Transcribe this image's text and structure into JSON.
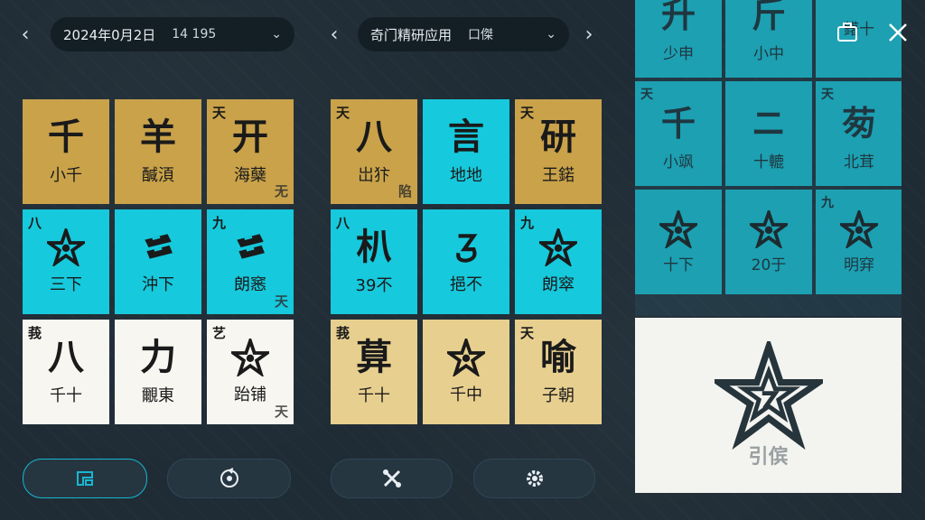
{
  "left_header": {
    "date": "2024年0月2日",
    "time": "14 195"
  },
  "mid_header": {
    "title": "奇门精研应用",
    "sub": "口傑"
  },
  "left_grid": [
    {
      "big": "千",
      "small": "小千",
      "corner": "",
      "corner_br": "",
      "color": "gold"
    },
    {
      "big": "羊",
      "small": "醎湏",
      "corner": "",
      "corner_br": "",
      "color": "gold"
    },
    {
      "big": "开",
      "small": "海蘖",
      "corner": "天",
      "corner_br": "无",
      "color": "gold"
    },
    {
      "big": "",
      "small": "三下",
      "corner": "八",
      "corner_br": "",
      "color": "cyan",
      "icon": "star"
    },
    {
      "big": "",
      "small": "沖下",
      "corner": "",
      "corner_br": "",
      "color": "cyan",
      "icon": "bars"
    },
    {
      "big": "",
      "small": "朗窸",
      "corner": "九",
      "corner_br": "天",
      "color": "cyan",
      "icon": "bars"
    },
    {
      "big": "八",
      "small": "千十",
      "corner": "莪",
      "corner_br": "",
      "color": "white"
    },
    {
      "big": "力",
      "small": "覼東",
      "corner": "",
      "corner_br": "",
      "color": "white"
    },
    {
      "big": "",
      "small": "跆铺",
      "corner": "艺",
      "corner_br": "天",
      "color": "white",
      "icon": "star"
    }
  ],
  "mid_grid": [
    {
      "big": "八",
      "small": "岀犿",
      "corner": "天",
      "corner_br": "陷",
      "color": "gold"
    },
    {
      "big": "言",
      "small": "地地",
      "corner": "",
      "corner_br": "",
      "color": "cyan"
    },
    {
      "big": "研",
      "small": "王鍩",
      "corner": "天",
      "corner_br": "",
      "color": "gold"
    },
    {
      "big": "朳",
      "small": "39不",
      "corner": "八",
      "corner_br": "",
      "color": "cyan"
    },
    {
      "big": "",
      "small": "挹不",
      "corner": "",
      "corner_br": "",
      "color": "cyan",
      "icon": "swirl"
    },
    {
      "big": "",
      "small": "朗窣",
      "corner": "九",
      "corner_br": "",
      "color": "cyan",
      "icon": "star"
    },
    {
      "big": "萛",
      "small": "千十",
      "corner": "莪",
      "corner_br": "",
      "color": "cream"
    },
    {
      "big": "",
      "small": "千中",
      "corner": "",
      "corner_br": "",
      "color": "cream",
      "icon": "star"
    },
    {
      "big": "喻",
      "small": "子朝",
      "corner": "天",
      "corner_br": "",
      "color": "cream"
    }
  ],
  "right_grid": [
    {
      "big": "升",
      "small": "少申",
      "corner": ""
    },
    {
      "big": "斤",
      "small": "小中",
      "corner": ""
    },
    {
      "big": "",
      "small": "鐯十",
      "corner": ""
    },
    {
      "big": "千",
      "small": "小飒",
      "corner": "天"
    },
    {
      "big": "ニ",
      "small": "十轆",
      "corner": ""
    },
    {
      "big": "茐",
      "small": "北茸",
      "corner": "天"
    },
    {
      "big": "",
      "small": "十下",
      "corner": "",
      "icon": "star"
    },
    {
      "big": "",
      "small": "20于",
      "corner": "",
      "icon": "star"
    },
    {
      "big": "",
      "small": "明穽",
      "corner": "九",
      "icon": "star"
    }
  ],
  "right_bottom": {
    "label": "引傧"
  },
  "colors": {
    "gold": "#c9a24a",
    "cyan": "#16c9dc",
    "white": "#f7f6f1",
    "cream": "#e7cf8f"
  }
}
